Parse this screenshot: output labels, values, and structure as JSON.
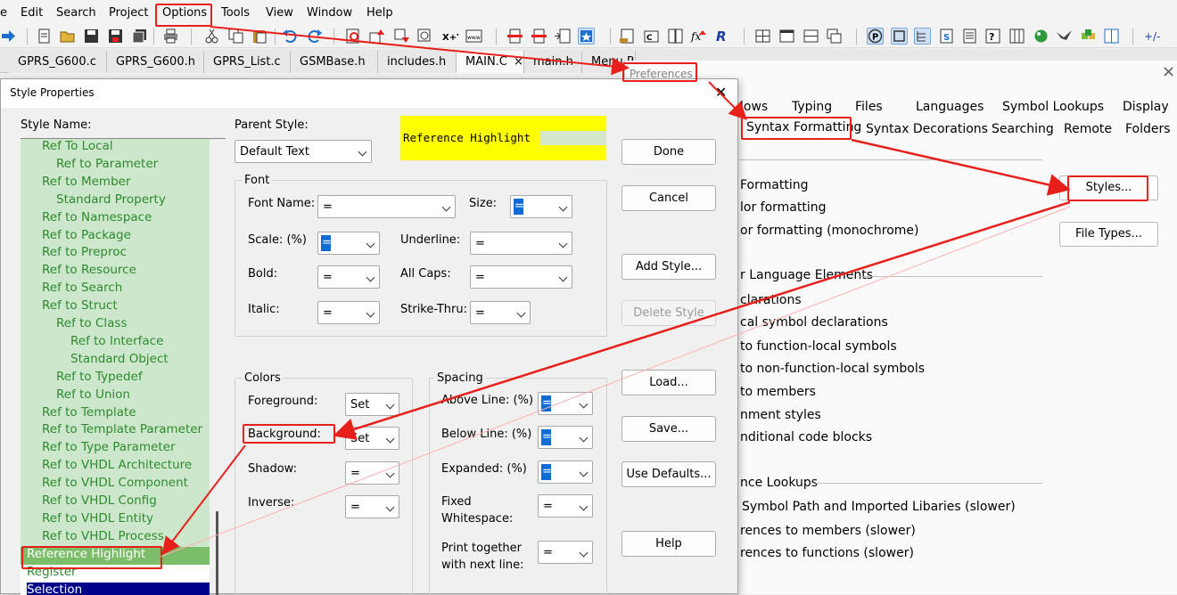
{
  "menu": {
    "items": [
      "e",
      "Edit",
      "Search",
      "Project",
      "Options",
      "Tools",
      "View",
      "Window",
      "Help"
    ]
  },
  "file_tabs": [
    "GPRS_G600.c",
    "GPRS_G600.h",
    "GPRS_List.c",
    "GSMBase.h",
    "includes.h",
    "MAIN.C",
    "main.h",
    "Menu.P"
  ],
  "active_tab_close": "×",
  "preferences": {
    "title": "Preferences",
    "tabs_row1": [
      "lows",
      "Typing",
      "Files",
      "Languages",
      "Symbol Lookups",
      "Display"
    ],
    "tabs_row2": [
      "Syntax Formatting",
      "Syntax Decorations",
      "Searching",
      "Remote",
      "Folders"
    ],
    "close": "×",
    "lines": [
      "Formatting",
      "lor formatting",
      "or formatting (monochrome)",
      "r Language Elements",
      "clarations",
      "cal symbol declarations",
      "to function-local symbols",
      "to non-function-local symbols",
      "to members",
      "nment styles",
      "nditional code blocks",
      "nce Lookups",
      "Symbol Path and Imported Libaries (slower)",
      "rences to members (slower)",
      "rences to functions (slower)"
    ],
    "styles_button": "Styles...",
    "file_types_button": "File Types..."
  },
  "dialog": {
    "title": "Style Properties",
    "close": "✕",
    "style_name_label": "Style Name:",
    "parent_style_label": "Parent Style:",
    "parent_style_value": "Default Text",
    "preview_text": "Reference Highlight",
    "font": {
      "group_label": "Font",
      "font_name_label": "Font Name:",
      "font_name_value": "=",
      "size_label": "Size:",
      "size_value": "=",
      "scale_label": "Scale: (%)",
      "scale_value": "=",
      "underline_label": "Underline:",
      "underline_value": "=",
      "bold_label": "Bold:",
      "bold_value": "=",
      "allcaps_label": "All Caps:",
      "allcaps_value": "=",
      "italic_label": "Italic:",
      "italic_value": "=",
      "strikethru_label": "Strike-Thru:",
      "strikethru_value": "="
    },
    "colors": {
      "group_label": "Colors",
      "foreground_label": "Foreground:",
      "foreground_value": "Set",
      "background_label": "Background:",
      "background_value": "Set",
      "shadow_label": "Shadow:",
      "shadow_value": "=",
      "inverse_label": "Inverse:",
      "inverse_value": "="
    },
    "spacing": {
      "group_label": "Spacing",
      "above_label": "Above Line: (%)",
      "above_value": "=",
      "below_label": "Below Line: (%)",
      "below_value": "=",
      "expanded_label": "Expanded: (%)",
      "expanded_value": "=",
      "fixed_label_1": "Fixed",
      "fixed_label_2": "Whitespace:",
      "fixed_value": "=",
      "print_label_1": "Print together",
      "print_label_2": "with next line:",
      "print_value": "="
    },
    "buttons": {
      "done": "Done",
      "cancel": "Cancel",
      "add_style": "Add Style...",
      "delete_style": "Delete Style",
      "load": "Load...",
      "save": "Save...",
      "use_defaults": "Use Defaults...",
      "help": "Help"
    },
    "tree_items": [
      "Ref To Local",
      "Ref to Parameter",
      "Ref to Member",
      "Standard Property",
      "Ref to Namespace",
      "Ref to Package",
      "Ref to Preproc",
      "Ref to Resource",
      "Ref to Search",
      "Ref to Struct",
      "Ref to Class",
      "Ref to Interface",
      "Standard Object",
      "Ref to Typedef",
      "Ref to Union",
      "Ref to Template",
      "Ref to Template Parameter",
      "Ref to Type Parameter",
      "Ref to VHDL Architecture",
      "Ref to VHDL Component",
      "Ref to VHDL Config",
      "Ref to VHDL Entity",
      "Ref to VHDL Process",
      "Reference Highlight",
      "Register",
      "Selection"
    ]
  },
  "colors": {
    "annotation_red": "#e8201c",
    "preview_yellow": "#ffff00",
    "tree_green": "#2d8a2d",
    "selection_green": "#7cbd6a"
  }
}
